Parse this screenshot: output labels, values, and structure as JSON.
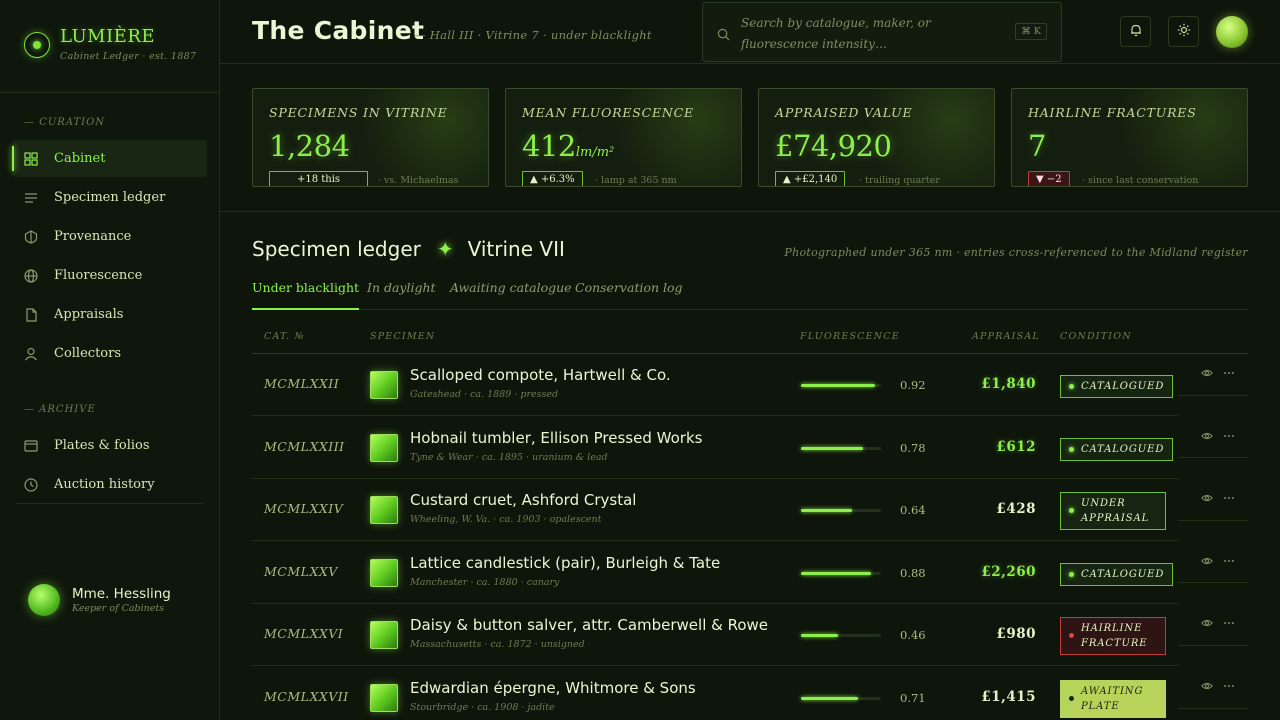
{
  "brand": {
    "name": "LUMIÈRE",
    "subtitle": "Cabinet Ledger · est. 1887"
  },
  "sidebar": {
    "curation_label": "— CURATION",
    "archive_label": "— ARCHIVE",
    "items": [
      {
        "label": "Cabinet",
        "icon": "grid-icon"
      },
      {
        "label": "Specimen ledger",
        "icon": "lines-icon"
      },
      {
        "label": "Provenance",
        "icon": "shield-icon"
      },
      {
        "label": "Fluorescence",
        "icon": "globe-icon"
      },
      {
        "label": "Appraisals",
        "icon": "document-icon"
      },
      {
        "label": "Collectors",
        "icon": "person-icon"
      }
    ],
    "archive_items": [
      {
        "label": "Plates & folios",
        "icon": "card-icon"
      },
      {
        "label": "Auction history",
        "icon": "clock-icon"
      }
    ],
    "user": {
      "name": "Mme. Hessling",
      "role": "Keeper of Cabinets"
    }
  },
  "header": {
    "title": "The Cabinet",
    "crumb": "— Hall III · Vitrine 7 · under blacklight",
    "search_placeholder": "Search by catalogue, maker, or fluorescence intensity…",
    "search_shortcut": "⌘ K"
  },
  "kpis": [
    {
      "label": "SPECIMENS IN VITRINE",
      "value": "1,284",
      "unit": "",
      "badge": "+18 this",
      "note": "· vs. Michaelmas"
    },
    {
      "label": "MEAN FLUORESCENCE",
      "value": "412",
      "unit": "lm/m²",
      "badge": "▲ +6.3%",
      "note": "· lamp at 365 nm"
    },
    {
      "label": "APPRAISED VALUE",
      "value": "£74,920",
      "unit": "",
      "badge": "▲ +£2,140",
      "note": "· trailing quarter"
    },
    {
      "label": "HAIRLINE FRACTURES",
      "value": "7",
      "unit": "",
      "badge": "▼ −2",
      "note": "· since last conservation"
    }
  ],
  "ledger": {
    "title": "Specimen ledger",
    "subtitle": "Vitrine VII",
    "note": "Photographed under 365 nm · entries cross-referenced to the Midland register",
    "tabs": [
      "Under blacklight",
      "In daylight",
      "Awaiting catalogue",
      "Conservation log"
    ],
    "columns": [
      "CAT. №",
      "SPECIMEN",
      "FLUORESCENCE",
      "APPRAISAL",
      "CONDITION"
    ],
    "rows": [
      {
        "cat": "MCMLXXII",
        "name": "Scalloped compote, Hartwell & Co.",
        "meta": "Gateshead · ca. 1889 · pressed",
        "fluor": 0.92,
        "fluor_text": "0.92",
        "appraisal": "£1,840",
        "condition": "CATALOGUED",
        "status": "catalogued"
      },
      {
        "cat": "MCMLXXIII",
        "name": "Hobnail tumbler, Ellison Pressed Works",
        "meta": "Tyne & Wear · ca. 1895 · uranium & lead",
        "fluor": 0.78,
        "fluor_text": "0.78",
        "appraisal": "£612",
        "condition": "CATALOGUED",
        "status": "catalogued"
      },
      {
        "cat": "MCMLXXIV",
        "name": "Custard cruet, Ashford Crystal",
        "meta": "Wheeling, W. Va. · ca. 1903 · opalescent",
        "fluor": 0.64,
        "fluor_text": "0.64",
        "appraisal": "£428",
        "condition": "UNDER APPRAISAL",
        "status": "under"
      },
      {
        "cat": "MCMLXXV",
        "name": "Lattice candlestick (pair), Burleigh & Tate",
        "meta": "Manchester · ca. 1880 · canary",
        "fluor": 0.88,
        "fluor_text": "0.88",
        "appraisal": "£2,260",
        "condition": "CATALOGUED",
        "status": "catalogued"
      },
      {
        "cat": "MCMLXXVI",
        "name": "Daisy & button salver, attr. Camberwell & Rowe",
        "meta": "Massachusetts · ca. 1872 · unsigned",
        "fluor": 0.46,
        "fluor_text": "0.46",
        "appraisal": "£980",
        "condition": "HAIRLINE FRACTURE",
        "status": "fracture"
      },
      {
        "cat": "MCMLXXVII",
        "name": "Edwardian épergne, Whitmore & Sons",
        "meta": "Stourbridge · ca. 1908 · jadite",
        "fluor": 0.71,
        "fluor_text": "0.71",
        "appraisal": "£1,415",
        "condition": "AWAITING PLATE",
        "status": "awaiting"
      }
    ]
  },
  "colors": {
    "accent": "#8cf04a",
    "background": "#0e150b",
    "danger": "#c43b3b"
  }
}
